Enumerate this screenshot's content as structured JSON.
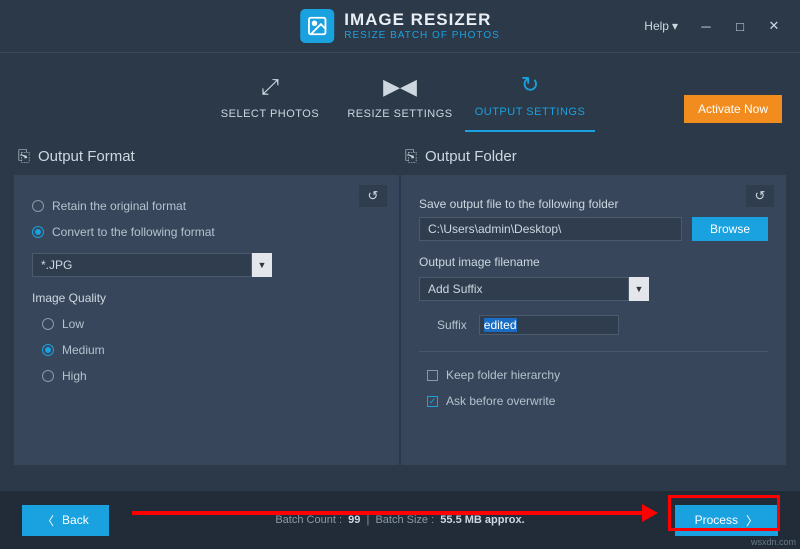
{
  "header": {
    "title": "IMAGE RESIZER",
    "subtitle": "RESIZE BATCH OF PHOTOS",
    "help": "Help"
  },
  "tabs": {
    "select": "SELECT PHOTOS",
    "resize": "RESIZE SETTINGS",
    "output": "OUTPUT SETTINGS"
  },
  "activate": "Activate Now",
  "format_panel": {
    "title": "Output Format",
    "retain": "Retain the original format",
    "convert": "Convert to the following format",
    "format_value": "*.JPG",
    "quality_label": "Image Quality",
    "low": "Low",
    "medium": "Medium",
    "high": "High"
  },
  "folder_panel": {
    "title": "Output Folder",
    "save_label": "Save output file to the following folder",
    "path": "C:\\Users\\admin\\Desktop\\",
    "browse": "Browse",
    "filename_label": "Output image filename",
    "filename_mode": "Add Suffix",
    "suffix_label": "Suffix",
    "suffix_value": "edited",
    "keep_hierarchy": "Keep folder hierarchy",
    "ask_overwrite": "Ask before overwrite"
  },
  "footer": {
    "back": "Back",
    "process": "Process",
    "batch_count_label": "Batch Count :",
    "batch_count": "99",
    "batch_size_label": "Batch Size :",
    "batch_size": "55.5 MB approx."
  },
  "watermark": "wsxdn.com"
}
